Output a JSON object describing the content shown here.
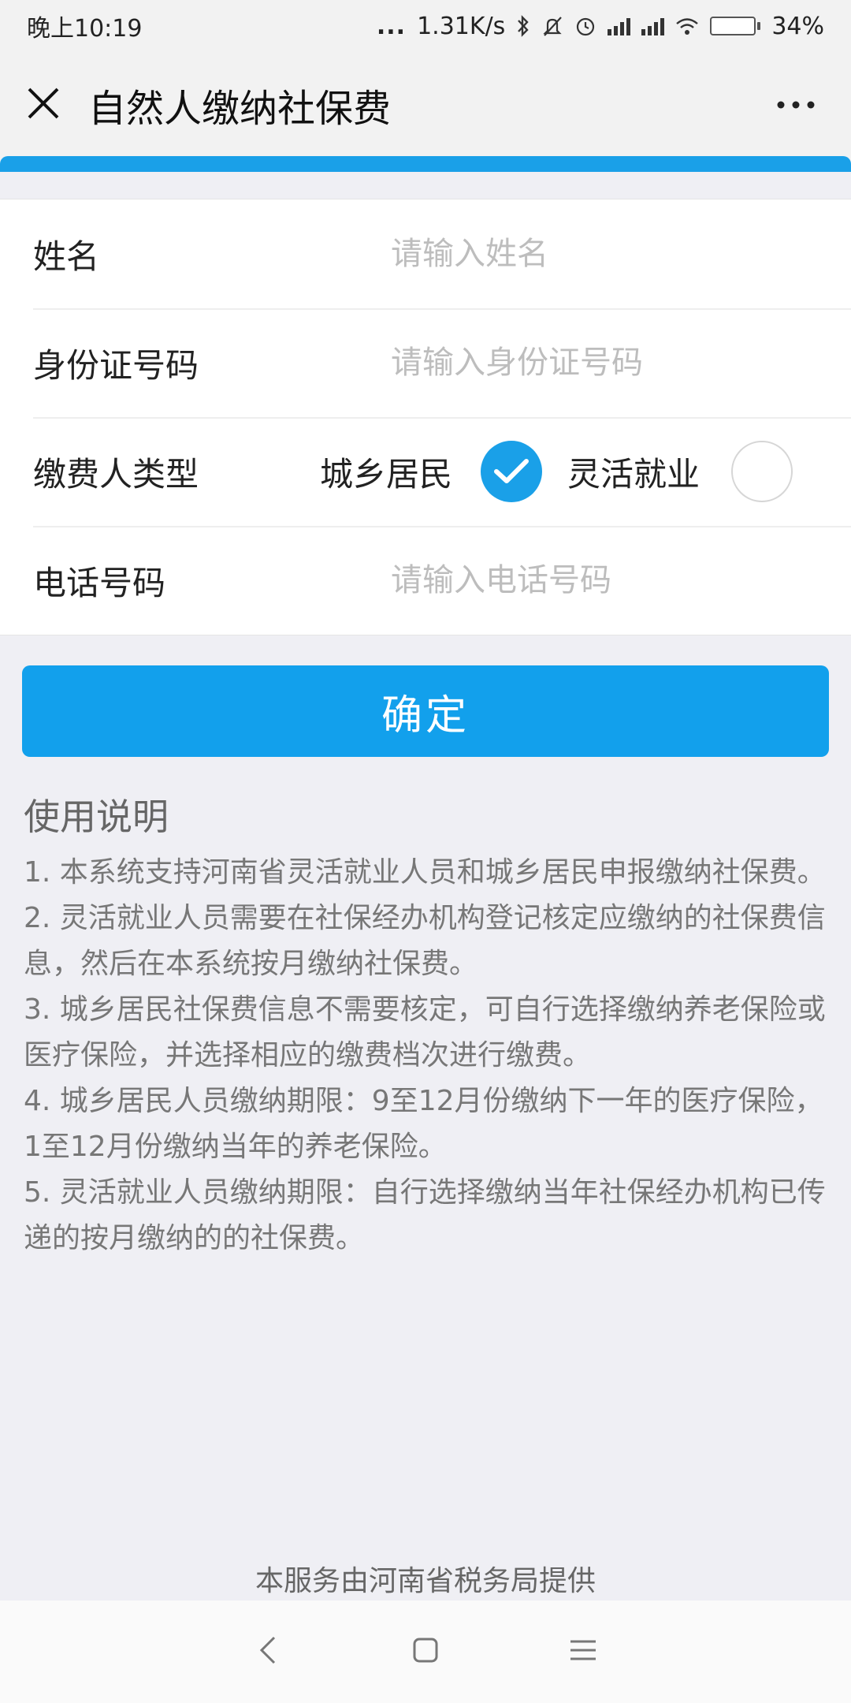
{
  "status_bar": {
    "time": "晚上10:19",
    "network_dots": "...",
    "speed": "1.31K/s",
    "battery_percent": "34%",
    "battery_level": 0.34,
    "icons": [
      "bluetooth-icon",
      "mute-icon",
      "alarm-icon",
      "signal-icon",
      "signal-icon",
      "wifi-icon",
      "battery-icon"
    ]
  },
  "nav": {
    "title": "自然人缴纳社保费",
    "close_icon": "close-icon",
    "more_icon": "more-icon"
  },
  "progress": {
    "value": 1.0,
    "color": "#1aa0e8"
  },
  "form": {
    "name": {
      "label": "姓名",
      "placeholder": "请输入姓名",
      "value": ""
    },
    "id_number": {
      "label": "身份证号码",
      "placeholder": "请输入身份证号码",
      "value": ""
    },
    "payer_type": {
      "label": "缴费人类型",
      "options": [
        {
          "label": "城乡居民",
          "checked": true
        },
        {
          "label": "灵活就业",
          "checked": false
        }
      ]
    },
    "phone": {
      "label": "电话号码",
      "placeholder": "请输入电话号码",
      "value": ""
    }
  },
  "confirm_button": {
    "label": "确定",
    "color": "#12a0ec"
  },
  "instructions": {
    "title": "使用说明",
    "items": [
      "1. 本系统支持河南省灵活就业人员和城乡居民申报缴纳社保费。",
      "2. 灵活就业人员需要在社保经办机构登记核定应缴纳的社保费信息，然后在本系统按月缴纳社保费。",
      "3. 城乡居民社保费信息不需要核定，可自行选择缴纳养老保险或医疗保险，并选择相应的缴费档次进行缴费。",
      "4. 城乡居民人员缴纳期限：9至12月份缴纳下一年的医疗保险，1至12月份缴纳当年的养老保险。",
      "5. 灵活就业人员缴纳期限：自行选择缴纳当年社保经办机构已传递的按月缴纳的的社保费。"
    ]
  },
  "footer": {
    "note": "本服务由河南省税务局提供"
  },
  "android_nav": {
    "icons": [
      "back-icon",
      "home-icon",
      "menu-icon"
    ]
  }
}
